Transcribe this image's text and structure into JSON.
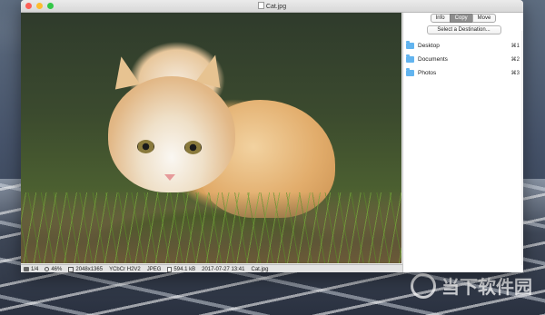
{
  "window": {
    "title": "Cat.jpg"
  },
  "statusbar": {
    "index": "1/4",
    "zoom": "46%",
    "dimensions": "2048x1365",
    "color_model": "YCbCr H2V2",
    "format": "JPEG",
    "file_size": "594.1 kB",
    "date": "2017-07-27 13:41",
    "filename": "Cat.jpg"
  },
  "sidebar": {
    "tabs": [
      {
        "label": "Info",
        "active": false
      },
      {
        "label": "Copy",
        "active": true
      },
      {
        "label": "Move",
        "active": false
      }
    ],
    "select_destination": "Select a Destination...",
    "destinations": [
      {
        "label": "Desktop",
        "shortcut": "⌘1",
        "icon": "folder-icon"
      },
      {
        "label": "Documents",
        "shortcut": "⌘2",
        "icon": "folder-icon"
      },
      {
        "label": "Photos",
        "shortcut": "⌘3",
        "icon": "folder-icon"
      }
    ]
  },
  "watermark": {
    "text": "当下软件园"
  },
  "colors": {
    "close": "#fc5f57",
    "minimize": "#fdbc2e",
    "maximize": "#33c748",
    "folder": "#62b4ef",
    "tab_active": "#8e8e8e"
  }
}
